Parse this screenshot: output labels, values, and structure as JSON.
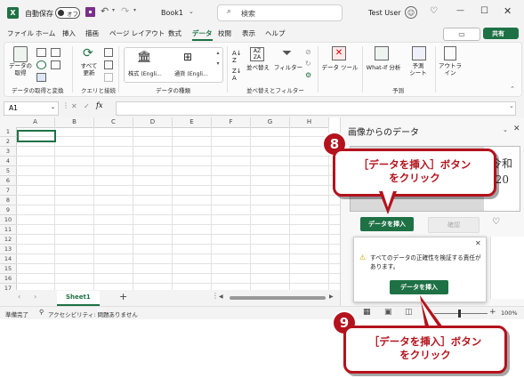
{
  "titlebar": {
    "autosave_label": "自動保存",
    "autosave_state": "オフ",
    "book_name": "Book1",
    "search_placeholder": "検索",
    "user_name": "Test User"
  },
  "ribbon_tabs": [
    "ファイル",
    "ホーム",
    "挿入",
    "描画",
    "ページ レイアウト",
    "数式",
    "データ",
    "校閲",
    "表示",
    "ヘルプ"
  ],
  "ribbon_actions": {
    "comment": "",
    "share": "共有"
  },
  "ribbon": {
    "get_data": "データの\n取得",
    "group1_label": "データの取得と変換",
    "refresh_all": "すべて\n更新",
    "group2_label": "クエリと接続",
    "stock": "株式 (Engli...",
    "currency": "通貨 (Engli...",
    "group3_label": "データの種類",
    "sort": "並べ替え",
    "filter": "フィルター",
    "group4_label": "並べ替えとフィルター",
    "data_tools": "データ ツール",
    "whatif": "What-If 分析",
    "forecast_sheet": "予測\nシート",
    "group5_label": "予測",
    "outline": "アウトラ\nイン"
  },
  "formula_bar": {
    "name_box": "A1",
    "fx": "fx"
  },
  "grid": {
    "columns": [
      "A",
      "B",
      "C",
      "D",
      "E",
      "F",
      "G",
      "H"
    ],
    "rows": [
      "1",
      "2",
      "3",
      "4",
      "5",
      "6",
      "7",
      "8",
      "9",
      "10",
      "11",
      "12",
      "13",
      "14",
      "15",
      "16",
      "17"
    ]
  },
  "sheet_tab": "Sheet1",
  "statusbar": {
    "ready": "準備完了",
    "accessibility": "アクセシビリティ: 問題ありません",
    "zoom": "100%"
  },
  "pane": {
    "title": "画像からのデータ",
    "insert_button": "データを挿入",
    "review_button": "確認",
    "warning_text": "すべてのデータの正確性を検証する責任があります。",
    "insert_button_2": "データを挿入",
    "preview_char": "令和",
    "preview_num": "(20"
  },
  "callouts": [
    {
      "number": "8",
      "text": "［データを挿入］ボタン\nをクリック"
    },
    {
      "number": "9",
      "text": "［データを挿入］ボタン\nをクリック"
    }
  ],
  "colors": {
    "excel_green": "#1e7145",
    "callout_red": "#b4121c"
  }
}
